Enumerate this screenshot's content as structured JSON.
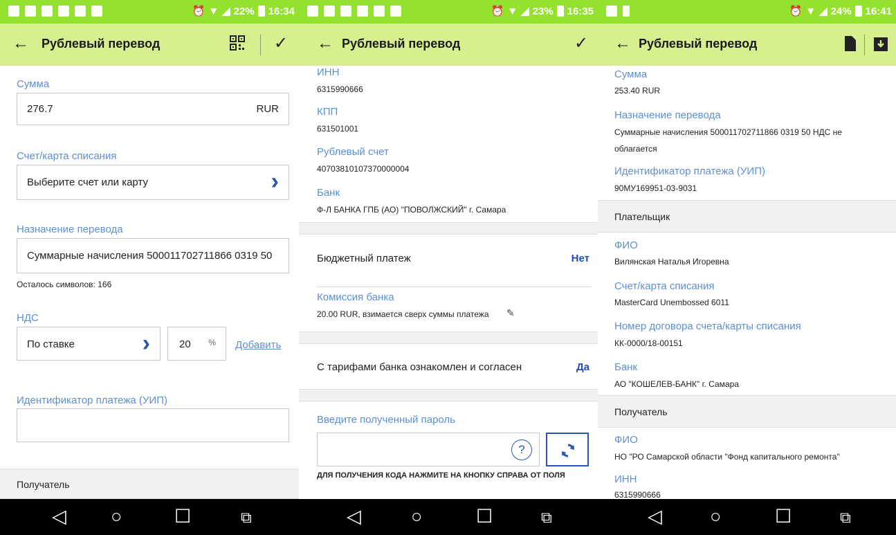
{
  "screens": [
    {
      "status": {
        "battery": "22%",
        "time": "16:34"
      },
      "title": "Рублевый перевод",
      "fields": {
        "amount": {
          "label": "Сумма",
          "value": "276.7",
          "currency": "RUR"
        },
        "account": {
          "label": "Счет/карта списания",
          "placeholder": "Выберите счет или карту"
        },
        "purpose": {
          "label": "Назначение перевода",
          "value": "Суммарные начисления 500011702711866 0319 50",
          "remaining": "Осталось символов: 166"
        },
        "vat": {
          "label": "НДС",
          "mode": "По ставке",
          "rate": "20",
          "percent": "%",
          "add": "Добавить"
        },
        "uip": {
          "label": "Идентификатор платежа (УИП)",
          "value": ""
        }
      },
      "section": "Получатель"
    },
    {
      "status": {
        "battery": "23%",
        "time": "16:35"
      },
      "title": "Рублевый перевод",
      "inn": {
        "label": "ИНН",
        "value": "6315990666"
      },
      "kpp": {
        "label": "КПП",
        "value": "631501001"
      },
      "account": {
        "label": "Рублевый счет",
        "value": "40703810107370000004"
      },
      "bank": {
        "label": "Банк",
        "value": "Ф-Л БАНКА ГПБ (АО) \"ПОВОЛЖСКИЙ\" г. Самара"
      },
      "budget": {
        "label": "Бюджетный платеж",
        "value": "Нет"
      },
      "fee": {
        "label": "Комиссия банка",
        "value": "20.00 RUR, взимается сверх суммы платежа"
      },
      "tariffs": {
        "label": "С тарифами банка ознакомлен и согласен",
        "value": "Да"
      },
      "password": {
        "label": "Введите полученный пароль",
        "help": "?",
        "hint": "Для получения кода нажмите на кнопку справа от поля"
      }
    },
    {
      "status": {
        "battery": "24%",
        "time": "16:41"
      },
      "title": "Рублевый перевод",
      "amount": {
        "label": "Сумма",
        "value": "253.40 RUR"
      },
      "purpose": {
        "label": "Назначение перевода",
        "line1": "Суммарные начисления 500011702711866 0319 50 НДС не",
        "line2": "облагается"
      },
      "uip": {
        "label": "Идентификатор платежа (УИП)",
        "value": "90МУ169951-03-9031"
      },
      "payer": {
        "title": "Плательщик",
        "fio_label": "ФИО",
        "fio": "Вилянская Наталья Игоревна",
        "acc_label": "Счет/карта списания",
        "acc": "MasterCard Unembossed 6011",
        "contract_label": "Номер договора счета/карты списания",
        "contract": "КК-0000/18-00151",
        "bank_label": "Банк",
        "bank": "АО \"КОШЕЛЕВ-БАНК\" г. Самара"
      },
      "recipient": {
        "title": "Получатель",
        "fio_label": "ФИО",
        "fio": "НО \"РО Самарской области \"Фонд капитального ремонта\"",
        "inn_label": "ИНН",
        "inn": "6315990666"
      }
    }
  ],
  "colors": {
    "statusbar": "#94e22e",
    "appbar": "#d8ef8f",
    "label": "#5b8fd6",
    "accent": "#2854b2",
    "value_blue": "#1e4db8"
  },
  "icons": {
    "back": "arrow-left-icon",
    "check": "check-icon",
    "qr": "qr-code-icon",
    "doc": "document-icon",
    "download": "download-icon",
    "refresh": "refresh-icon",
    "nav": [
      "back-triangle-icon",
      "home-circle-icon",
      "recents-square-icon",
      "screen-mirror-icon"
    ]
  }
}
